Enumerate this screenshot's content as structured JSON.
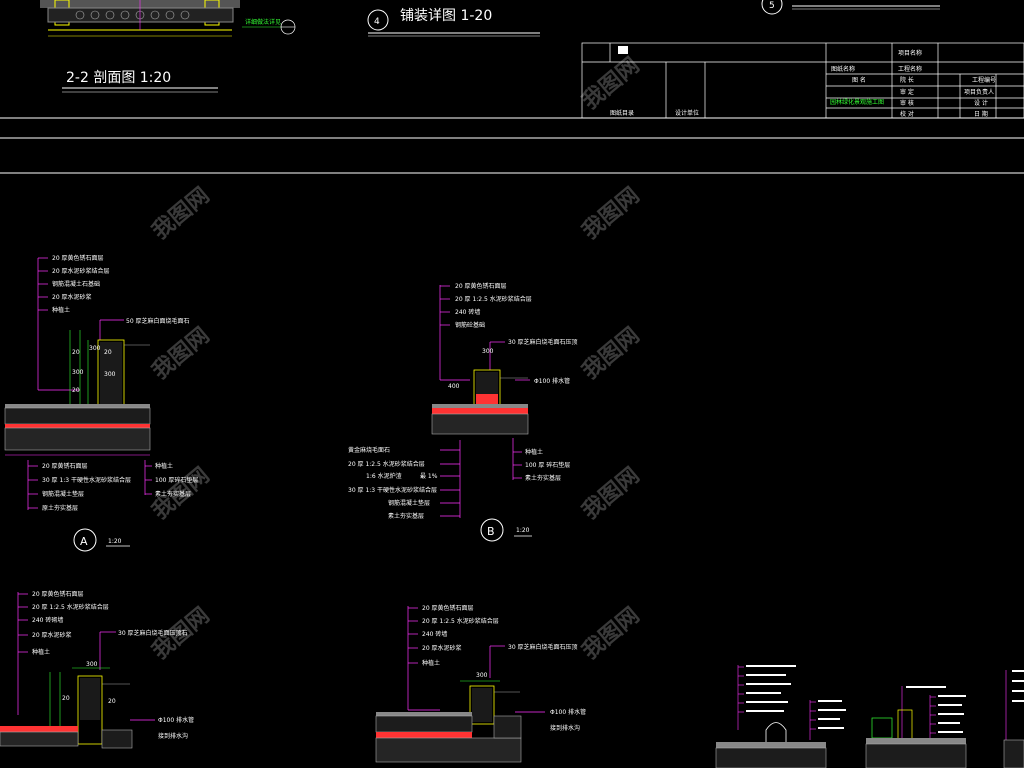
{
  "titles": {
    "section_22": "2-2 剖面图   1:20",
    "paving_detail": "铺装详图 1-20",
    "paving_detail_num": "4",
    "detail5_num": "5",
    "top_note": "详细做法详见"
  },
  "title_block": {
    "project_label": "项目名称",
    "drawing_name": "图纸名称",
    "project_no": "工程名称",
    "c1": "图  名",
    "c2": "院  长",
    "c3": "审  定",
    "c4": "审  核",
    "c5": "校  对",
    "c6": "工程编号",
    "c7": "项目负责人",
    "c8": "设  计",
    "c9": "日  期",
    "green_text": "园林绿化景观施工图",
    "small1": "图纸目录",
    "small2": "设计单位"
  },
  "detail_A": {
    "label": "A",
    "scale": "1:20",
    "top_notes": [
      "20 厚黄色锈石面层",
      "20 厚水泥砂浆结合层",
      "钢筋混凝土石基础",
      "20 厚水泥砂浆",
      "种植土"
    ],
    "side_note": "50 厚芝麻白面烧毛面石",
    "bottom_notes": [
      "20 厚黄锈石面层",
      "30 厚 1:3 干硬性水泥砂浆结合层",
      "钢筋混凝土垫层",
      "原土夯实基层"
    ],
    "right_notes": [
      "种植土",
      "100 厚碎石垫层",
      "素土夯实基层"
    ],
    "dims": [
      "20",
      "300",
      "20",
      "300",
      "20",
      "300"
    ]
  },
  "detail_B": {
    "label": "B",
    "scale": "1:20",
    "top_notes": [
      "20 厚黄色锈石面层",
      "20 厚 1:2.5 水泥砂浆结合层",
      "240 砖墙",
      "钢筋砼基础"
    ],
    "side_note": "30 厚芝麻白烧毛面石压顶",
    "pipe_note": "Φ100 排水管",
    "dim_top": "300",
    "dim_side": "400",
    "left_notes": [
      "黄金麻烧毛面石",
      "20 厚 1:2.5 水泥砂浆结合层",
      "1:6 水泥炉渣",
      "30 厚 1:3 干硬性水泥砂浆结合层",
      "钢筋混凝土垫层",
      "素土夯实基层"
    ],
    "left_note_dim": "最 1%",
    "right_notes": [
      "种植土",
      "100 厚 碎石垫层",
      "素土夯实基层"
    ]
  },
  "detail_C": {
    "top_notes": [
      "20 厚黄色锈石面层",
      "20 厚 1:2.5 水泥砂浆结合层",
      "240 砖砌墙",
      "20 厚水泥砂浆",
      "种植土"
    ],
    "side_note": "30 厚芝麻白烧毛面压顶石",
    "pipe_note": "Φ100 排水管",
    "pipe_note2": "接到排水沟",
    "dims": [
      "300",
      "20",
      "240",
      "20"
    ]
  },
  "detail_D": {
    "top_notes": [
      "20 厚黄色锈石面层",
      "20 厚 1:2.5 水泥砂浆结合层",
      "240 砖墙",
      "20 厚水泥砂浆",
      "种植土"
    ],
    "side_note": "30 厚芝麻白烧毛面石压顶",
    "pipe_note": "Φ100 排水管",
    "pipe_note2": "接到排水沟",
    "dim_top": "300"
  },
  "watermark": "我图网"
}
